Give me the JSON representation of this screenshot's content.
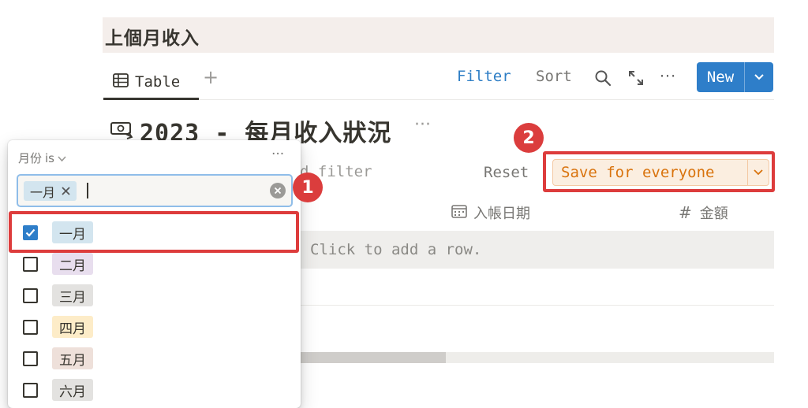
{
  "page": {
    "title": "上個月收入"
  },
  "toolbar": {
    "tab_label": "Table",
    "add_view": "+",
    "filter_label": "Filter",
    "sort_label": "Sort",
    "more": "···",
    "new_label": "New"
  },
  "database": {
    "title": "2023 - 每月收入狀況",
    "more": "···"
  },
  "filter_bar": {
    "add_filter_text": "d filter",
    "reset_label": "Reset",
    "save_label": "Save for everyone"
  },
  "columns": {
    "date": "入帳日期",
    "amount": "金額",
    "amount_symbol": "#"
  },
  "table": {
    "empty_row_text": "Click to add a row."
  },
  "filter_popup": {
    "property_label": "月份",
    "operator": "is",
    "more": "···",
    "selected_chip": "一月",
    "options": [
      {
        "label": "一月",
        "checked": true,
        "color": "#d3e5ef"
      },
      {
        "label": "二月",
        "checked": false,
        "color": "#e8deee"
      },
      {
        "label": "三月",
        "checked": false,
        "color": "#e3e2e0"
      },
      {
        "label": "四月",
        "checked": false,
        "color": "#fdecc8"
      },
      {
        "label": "五月",
        "checked": false,
        "color": "#eee0da"
      },
      {
        "label": "六月",
        "checked": false,
        "color": "#e3e2e0"
      }
    ]
  },
  "annotations": {
    "badge_1": "1",
    "badge_2": "2",
    "highlight_color": "#dd3c3c"
  },
  "colors": {
    "accent": "#2e7ec9",
    "save_text": "#d9730d",
    "save_bg": "#fbeee0"
  }
}
